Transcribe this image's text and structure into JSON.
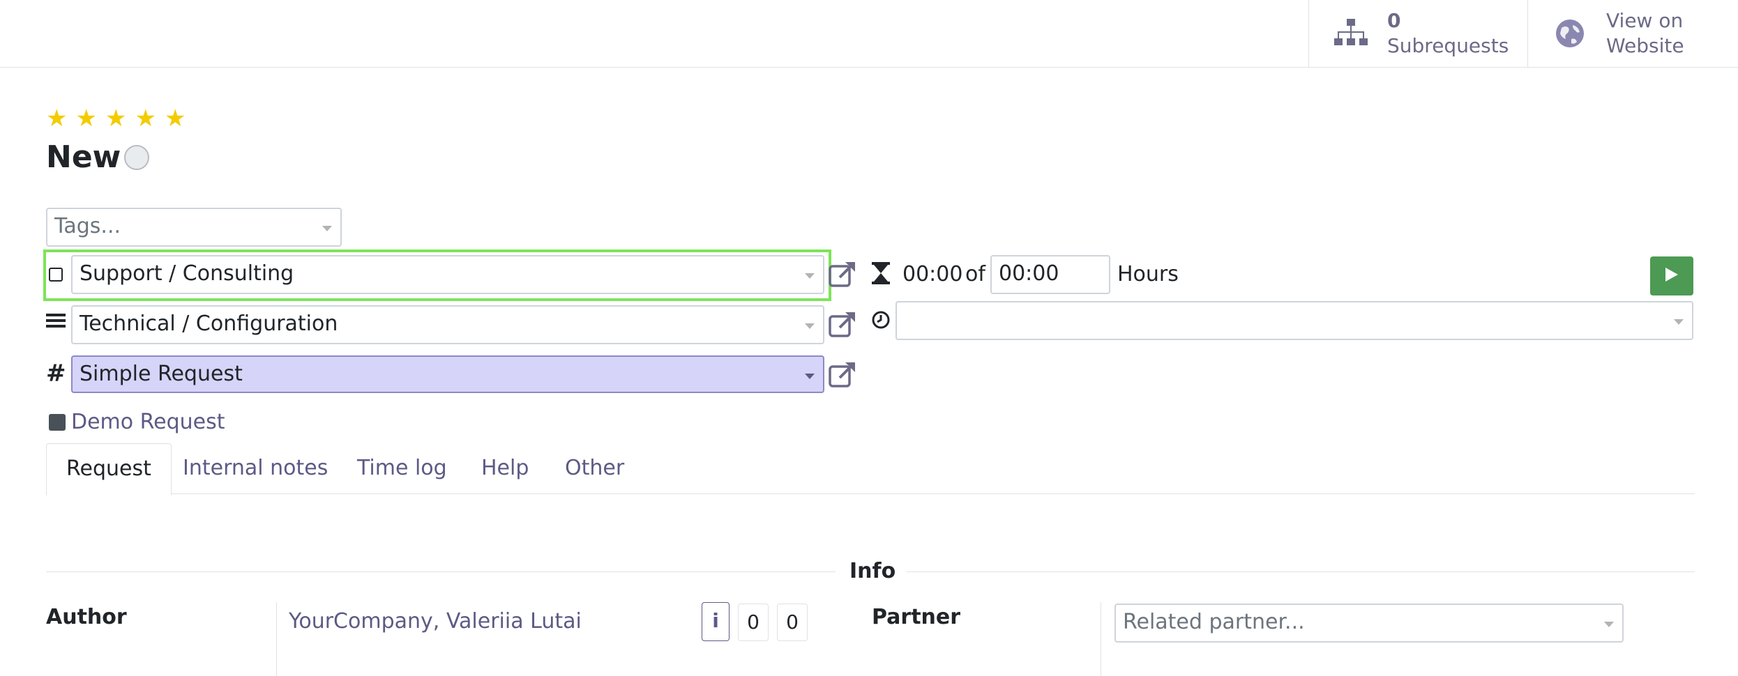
{
  "header": {
    "subrequests_count": "0",
    "subrequests_label": "Subrequests",
    "view_on_website_line1": "View on",
    "view_on_website_line2": "Website"
  },
  "record": {
    "priority_stars": 5,
    "stage": "New",
    "tags_placeholder": "Tags...",
    "service": "Support / Consulting",
    "category": "Technical / Configuration",
    "request_type": "Simple Request",
    "demo_link": "Demo Request"
  },
  "timer": {
    "spent": "00:00",
    "of_label": "of",
    "planned": "00:00",
    "unit": "Hours",
    "deadline_value": ""
  },
  "tabs": [
    {
      "label": "Request"
    },
    {
      "label": "Internal notes"
    },
    {
      "label": "Time log"
    },
    {
      "label": "Help"
    },
    {
      "label": "Other"
    }
  ],
  "info": {
    "section_title": "Info",
    "author_label": "Author",
    "author_value": "YourCompany, Valeriia Lutai",
    "info_badge": "i",
    "count_a": "0",
    "count_b": "0",
    "partner_label": "Partner",
    "partner_placeholder": "Related partner..."
  },
  "colors": {
    "accent": "#5c5a85",
    "highlight_outline": "#7fe35a",
    "request_type_bg": "#d6d4f8",
    "play_green": "#4c9a53",
    "star": "#f3cc00"
  }
}
